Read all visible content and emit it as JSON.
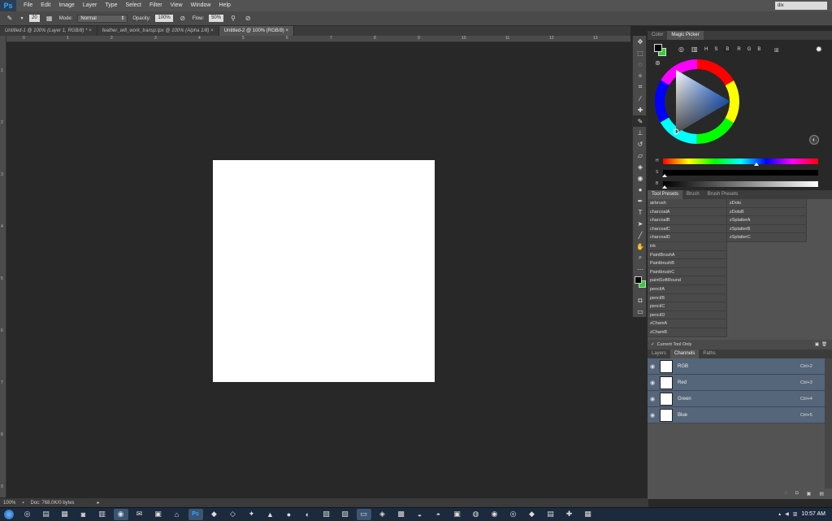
{
  "app": {
    "logo": "Ps"
  },
  "menu": [
    "File",
    "Edit",
    "Image",
    "Layer",
    "Type",
    "Select",
    "Filter",
    "View",
    "Window",
    "Help"
  ],
  "search": {
    "value": "dix"
  },
  "options": {
    "brush_size": "20",
    "mode_label": "Mode:",
    "mode_value": "Normal",
    "opacity_label": "Opacity:",
    "opacity_value": "100%",
    "flow_label": "Flow:",
    "flow_value": "50%"
  },
  "doc_tabs": [
    {
      "label": "Untitled-1 @ 100% (Layer 1, RGB/8) *",
      "active": false
    },
    {
      "label": "feather_will_work_transp.tpx @ 100% (Alpha 1/8)",
      "active": false
    },
    {
      "label": "Untitled-2 @ 100% (RGB/8)",
      "active": true
    }
  ],
  "ruler_top": [
    "0",
    "1",
    "2",
    "3",
    "4",
    "5",
    "6",
    "7",
    "8",
    "9",
    "10",
    "11",
    "12",
    "13"
  ],
  "ruler_left": [
    "1",
    "2",
    "3",
    "4",
    "5",
    "6",
    "7",
    "8",
    "9"
  ],
  "status": {
    "zoom": "100%",
    "doc": "Doc: 768.0K/0 bytes"
  },
  "color_panel": {
    "tabs": [
      "Color",
      "Magic Picker"
    ],
    "modes": [
      "H",
      "S",
      "B",
      "R",
      "G",
      "B"
    ],
    "sliders": [
      "H",
      "S",
      "B"
    ],
    "hue_marker_pct": 0.6,
    "saturation_marker_pct": 0.0,
    "brightness_marker_pct": 0.0
  },
  "preset_panel": {
    "tabs": [
      "Tool Presets",
      "Brush",
      "Brush Presets"
    ],
    "col1": [
      "airbrush",
      "charcoalA",
      "charcoalB",
      "charcoalC",
      "charcoalD",
      "ink",
      "PaintBrushA",
      "PaintbrushB",
      "PaintbrushC",
      "paintSoftRound",
      "pencilA",
      "pencilB",
      "pencilC",
      "pencilD",
      "zChamA",
      "zChamB"
    ],
    "col2": [
      "zDots",
      "zDotsB",
      "zSplatterA",
      "zSplatterB",
      "zSplatterC"
    ],
    "current_tool_only": "Current Tool Only"
  },
  "layers_panel": {
    "tabs": [
      "Layers",
      "Channels",
      "Paths"
    ],
    "channels": [
      {
        "name": "RGB",
        "shortcut": "Ctrl+2"
      },
      {
        "name": "Red",
        "shortcut": "Ctrl+3"
      },
      {
        "name": "Green",
        "shortcut": "Ctrl+4"
      },
      {
        "name": "Blue",
        "shortcut": "Ctrl+5"
      }
    ]
  },
  "taskbar": {
    "time": "10:57 AM"
  },
  "colors": {
    "foreground": "#000000",
    "background": "#2fd12f"
  }
}
